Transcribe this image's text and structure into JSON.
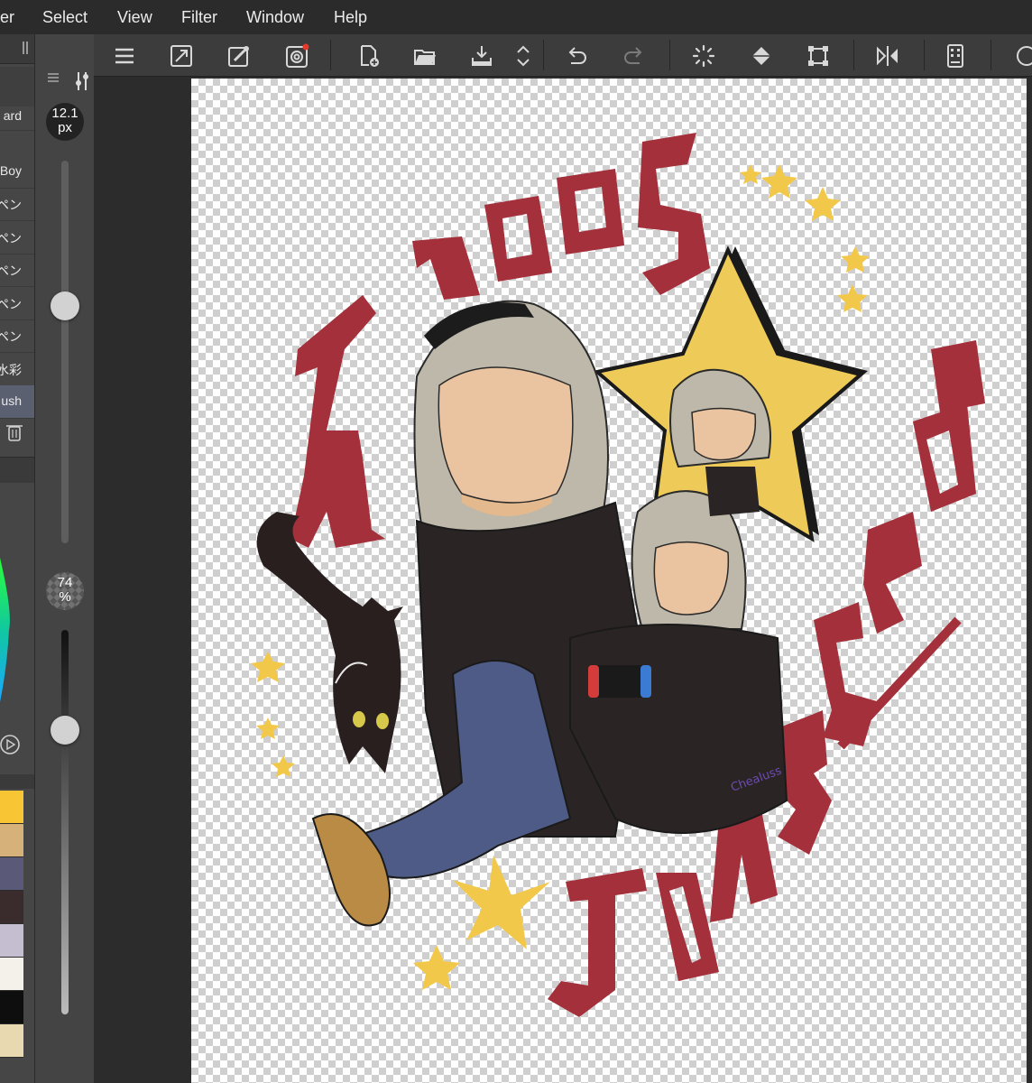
{
  "menu": {
    "items": [
      "er",
      "Select",
      "View",
      "Filter",
      "Window",
      "Help"
    ]
  },
  "brushes": {
    "items": [
      "ard",
      "Boy",
      "ペン",
      "ペン",
      "ペン",
      "ペン",
      "ペン",
      "水彩",
      "ush"
    ]
  },
  "brush_size": {
    "value": "12.1",
    "unit": "px",
    "level": 0.62
  },
  "opacity": {
    "value": "74",
    "unit": "%",
    "level": 0.74
  },
  "colors": {
    "swatches": [
      "#f8c634",
      "#d6b27a",
      "#5a5a78",
      "#3a2c2c",
      "#c5bdd0",
      "#f4f0ea",
      "#0e0e0e",
      "#e8d9b0"
    ],
    "accent": "#a3303a",
    "gold": "#f2c84b"
  },
  "artwork": {
    "title_top": "2003",
    "title_side": "JONGSEOB",
    "signature": "Chealuss"
  },
  "icons": [
    "menu-icon",
    "fit-icon",
    "eyedropper-icon",
    "smart-icon",
    "new-canvas-icon",
    "open-folder-icon",
    "save-icon",
    "stepper-icon",
    "undo-icon",
    "redo-icon",
    "loading-icon",
    "fill-icon",
    "transform-icon",
    "flip-icon",
    "device-icon"
  ]
}
